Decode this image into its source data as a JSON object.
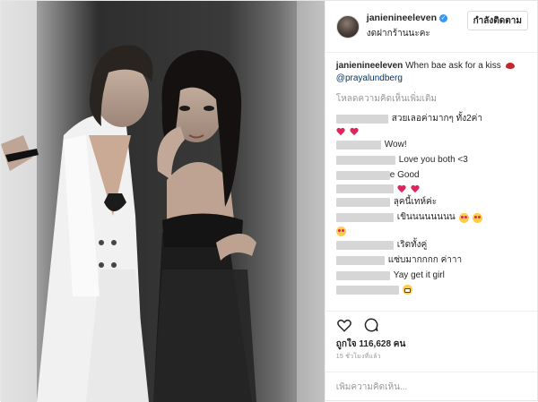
{
  "post": {
    "username": "janienineeleven",
    "location": "งดฝากร้านนะคะ",
    "follow_label": "กำลังติดตาม",
    "caption_text": "When bae ask for a kiss",
    "caption_mention": "@prayalundberg",
    "load_more": "โหลดความคิดเห็นเพิ่มเติม",
    "comments": [
      {
        "text": "สวยเลอค่ามากๆ ทั้ง2ค่า"
      },
      {
        "text": ""
      },
      {
        "text": "Wow!"
      },
      {
        "text": "Love you both <3"
      },
      {
        "text": "e Good"
      },
      {
        "text": ""
      },
      {
        "text": "ลุคนี้เทห์ค่ะ"
      },
      {
        "text": "เขินนนนนนนน"
      },
      {
        "text": ""
      },
      {
        "text": "เริดทั้งคู่"
      },
      {
        "text": "แซ่บมากกกก ค่าาา"
      },
      {
        "text": "Yay get it girl"
      },
      {
        "text": ""
      }
    ],
    "likes": "ถูกใจ 116,628 คน",
    "timestamp": "15 ชั่วโมงที่แล้ว",
    "comment_placeholder": "เพิ่มความคิดเห็น...",
    "icons": [
      "verified-icon",
      "heart-icon",
      "comment-icon",
      "lipstick-emoji",
      "heart-eyes-emoji",
      "grimace-emoji"
    ],
    "colors": {
      "link": "#003569",
      "verified": "#3897f0",
      "heart": "#e0245e",
      "muted": "#999999"
    }
  }
}
